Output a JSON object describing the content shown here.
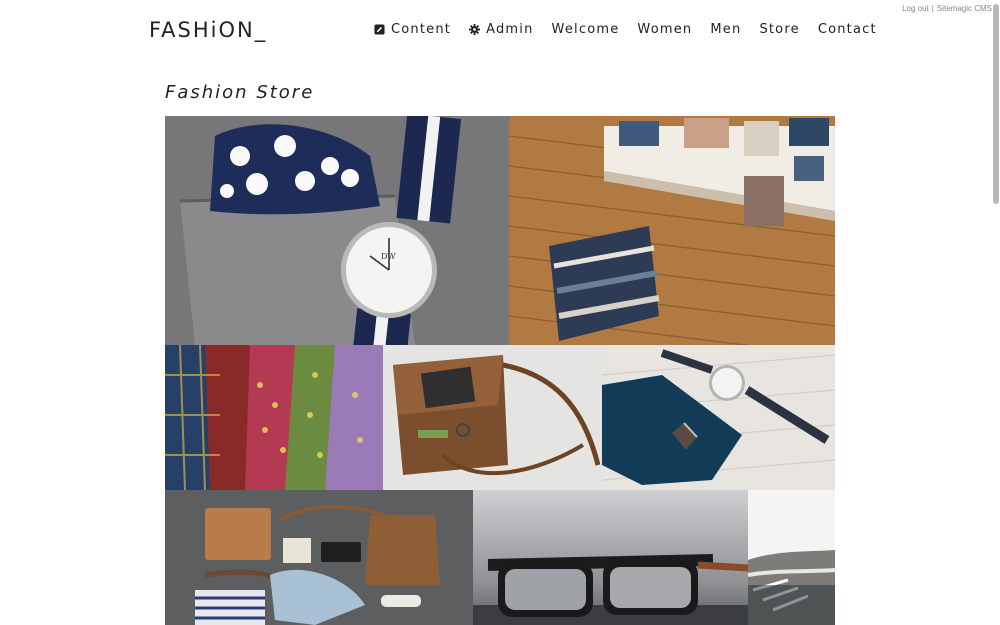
{
  "top_links": {
    "logout": "Log out",
    "separator": "|",
    "cms": "Sitemagic CMS"
  },
  "header": {
    "logo": "FASHiON_"
  },
  "nav": {
    "items": [
      {
        "label": "Content",
        "icon": "edit-icon"
      },
      {
        "label": "Admin",
        "icon": "gear-icon"
      },
      {
        "label": "Welcome"
      },
      {
        "label": "Women"
      },
      {
        "label": "Men"
      },
      {
        "label": "Store"
      },
      {
        "label": "Contact"
      }
    ]
  },
  "main": {
    "title": "Fashion Store"
  },
  "gallery": {
    "images": [
      {
        "subject": "watch-pocket-square"
      },
      {
        "subject": "store-interior"
      },
      {
        "subject": "ties"
      },
      {
        "subject": "leather-bag"
      },
      {
        "subject": "watch-tie"
      },
      {
        "subject": "accessories-flatlay"
      },
      {
        "subject": "glasses"
      },
      {
        "subject": "sneaker"
      }
    ]
  },
  "colors": {
    "text": "#222222",
    "muted": "#888888",
    "background": "#ffffff"
  }
}
